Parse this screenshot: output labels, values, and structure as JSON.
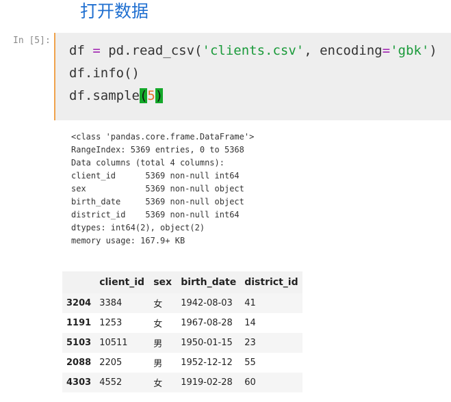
{
  "heading": "打开数据",
  "cell": {
    "prompt": "In [5]:",
    "line1": {
      "a": "df ",
      "eq": "=",
      "b": " pd.read_csv(",
      "s1": "'clients.csv'",
      "c": ", encoding",
      "eq2": "=",
      "s2": "'gbk'",
      "d": ")"
    },
    "line2": "df.info()",
    "line3": {
      "a": "df.sample",
      "p1": "(",
      "n": "5",
      "p2": ")"
    }
  },
  "info_output": [
    "<class 'pandas.core.frame.DataFrame'>",
    "RangeIndex: 5369 entries, 0 to 5368",
    "Data columns (total 4 columns):",
    "client_id      5369 non-null int64",
    "sex            5369 non-null object",
    "birth_date     5369 non-null object",
    "district_id    5369 non-null int64",
    "dtypes: int64(2), object(2)",
    "memory usage: 167.9+ KB"
  ],
  "table": {
    "columns": [
      "",
      "client_id",
      "sex",
      "birth_date",
      "district_id"
    ],
    "rows": [
      {
        "index": "3204",
        "client_id": "3384",
        "sex": "女",
        "birth_date": "1942-08-03",
        "district_id": "41"
      },
      {
        "index": "1191",
        "client_id": "1253",
        "sex": "女",
        "birth_date": "1967-08-28",
        "district_id": "14"
      },
      {
        "index": "5103",
        "client_id": "10511",
        "sex": "男",
        "birth_date": "1950-01-15",
        "district_id": "23"
      },
      {
        "index": "2088",
        "client_id": "2205",
        "sex": "男",
        "birth_date": "1952-12-12",
        "district_id": "55"
      },
      {
        "index": "4303",
        "client_id": "4552",
        "sex": "女",
        "birth_date": "1919-02-28",
        "district_id": "60"
      }
    ]
  },
  "colors": {
    "heading": "#1f6fd0",
    "string": "#1a9a3a",
    "operator": "#a020b0",
    "number": "#e8702a",
    "paren_highlight": "#14a82a",
    "cell_bg": "#eeeeee"
  }
}
